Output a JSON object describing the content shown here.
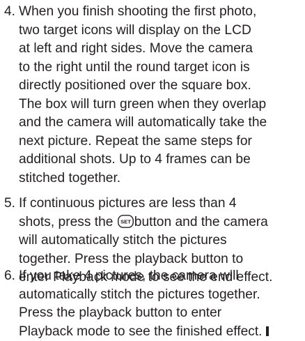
{
  "steps": [
    {
      "number": "4.",
      "lines": [
        "When you finish shooting the first photo,",
        "two target icons will display on the LCD",
        "at left and right sides. Move the camera",
        "to the right until the round target icon is",
        "directly positioned over the square box.",
        "The box will turn green when they overlap",
        "and the camera will automatically take the",
        "next picture. Repeat the same steps for",
        "additional shots. Up to 4 frames can be",
        "stitched together."
      ]
    },
    {
      "number": "5.",
      "lines": [
        "If continuous pictures are less than 4",
        {
          "before": "shots, press the",
          "icon_label": "SET",
          "after": "button and the camera"
        },
        "will automatically stitch the pictures",
        "together. Press the playback button to",
        "enter Playback mode to see the end effect."
      ]
    },
    {
      "number": "6.",
      "lines": [
        "If you take 4 pictures, the camera will",
        "automatically stitch the pictures together.",
        "Press the playback button to enter",
        "Playback mode to see the finished effect."
      ]
    }
  ],
  "icons": {
    "set_button": "set-button-icon",
    "end_marker": "end-of-section-marker"
  },
  "colors": {
    "text": "#231f20"
  }
}
